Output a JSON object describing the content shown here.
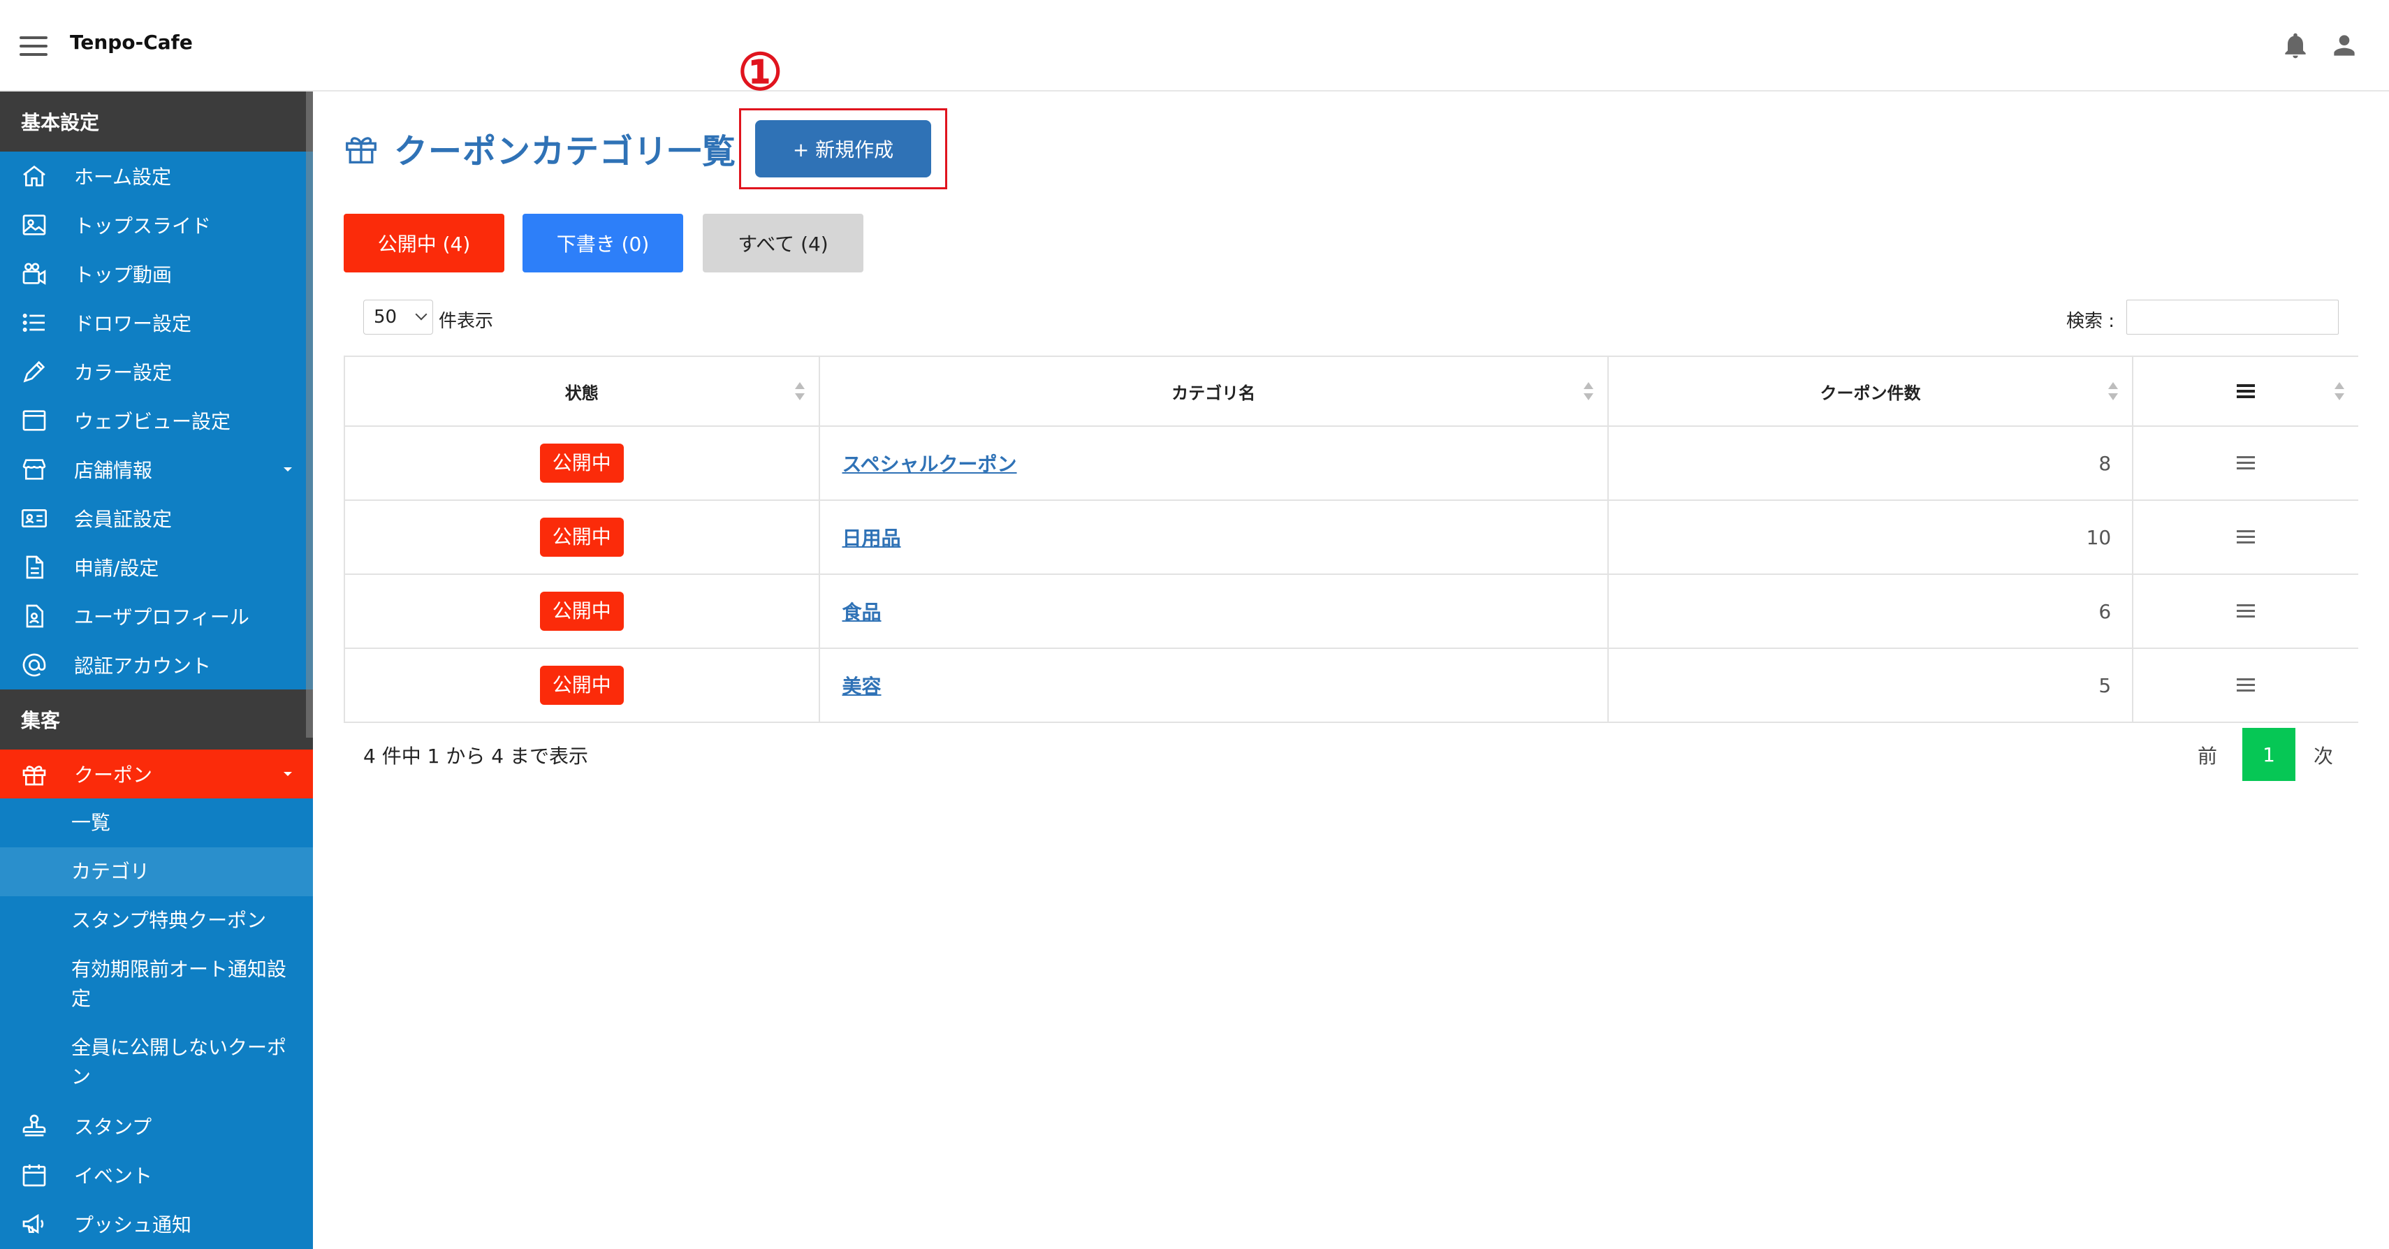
{
  "header": {
    "brand": "Tenpo-Cafe"
  },
  "sidebar": {
    "sections": [
      {
        "title": "基本設定",
        "items": [
          {
            "label": "ホーム設定",
            "icon": "home-icon"
          },
          {
            "label": "トップスライド",
            "icon": "image-icon"
          },
          {
            "label": "トップ動画",
            "icon": "video-camera-icon"
          },
          {
            "label": "ドロワー設定",
            "icon": "list-icon"
          },
          {
            "label": "カラー設定",
            "icon": "pencil-icon"
          },
          {
            "label": "ウェブビュー設定",
            "icon": "browser-window-icon"
          },
          {
            "label": "店舗情報",
            "icon": "store-icon"
          },
          {
            "label": "会員証設定",
            "icon": "id-card-icon"
          },
          {
            "label": "申請/設定",
            "icon": "document-icon"
          },
          {
            "label": "ユーザプロフィール",
            "icon": "user-profile-icon"
          },
          {
            "label": "認証アカウント",
            "icon": "at-sign-icon"
          }
        ]
      },
      {
        "title": "集客",
        "items": [
          {
            "label": "クーポン",
            "icon": "gift-icon"
          },
          {
            "label": "スタンプ",
            "icon": "stamp-icon"
          },
          {
            "label": "イベント",
            "icon": "calendar-icon"
          },
          {
            "label": "プッシュ通知",
            "icon": "megaphone-icon"
          }
        ]
      }
    ],
    "coupon_sub": [
      "一覧",
      "カテゴリ",
      "スタンプ特典クーポン",
      "有効期限前オート通知設定",
      "全員に公開しないクーポン"
    ],
    "active_color": "#fb2b0a",
    "bg_color": "#0f7fc4"
  },
  "main": {
    "title": "クーポンカテゴリ一覧",
    "new_button": "+ 新規作成",
    "step_mark": "①",
    "filters": {
      "published": "公開中 (4)",
      "draft": "下書き (0)",
      "all": "すべて (4)"
    },
    "length_value": "50",
    "length_label": "件表示",
    "search_label": "検索 :",
    "columns": [
      "状態",
      "カテゴリ名",
      "クーポン件数"
    ],
    "rows": [
      {
        "status": "公開中",
        "name": "スペシャルクーポン",
        "count": "8"
      },
      {
        "status": "公開中",
        "name": "日用品",
        "count": "10"
      },
      {
        "status": "公開中",
        "name": "食品",
        "count": "6"
      },
      {
        "status": "公開中",
        "name": "美容",
        "count": "5"
      }
    ],
    "info": "4 件中 1 から 4 まで表示",
    "pager": {
      "prev": "前",
      "current": "1",
      "next": "次"
    }
  }
}
